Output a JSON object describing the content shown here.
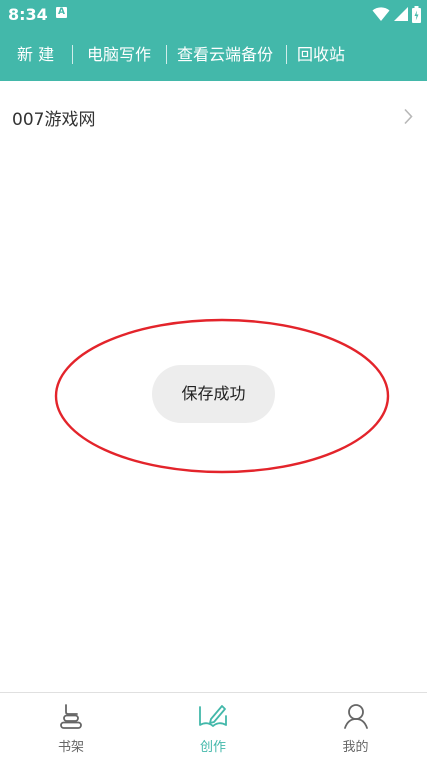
{
  "status_bar": {
    "time": "8:34",
    "notification_badge": "A"
  },
  "toolbar": {
    "items": [
      "新 建",
      "电脑写作",
      "查看云端备份",
      "回收站"
    ],
    "background_color": "#43b8aa"
  },
  "list": {
    "items": [
      {
        "label": "007游戏网"
      }
    ]
  },
  "toast": {
    "text": "保存成功"
  },
  "bottom_nav": {
    "items": [
      {
        "label": "书架",
        "icon": "bookshelf-icon",
        "active": false
      },
      {
        "label": "创作",
        "icon": "compose-icon",
        "active": true
      },
      {
        "label": "我的",
        "icon": "profile-icon",
        "active": false
      }
    ],
    "active_color": "#43b8aa",
    "inactive_color": "#666666"
  },
  "annotation": {
    "shape": "ellipse",
    "color": "#e3242b"
  }
}
